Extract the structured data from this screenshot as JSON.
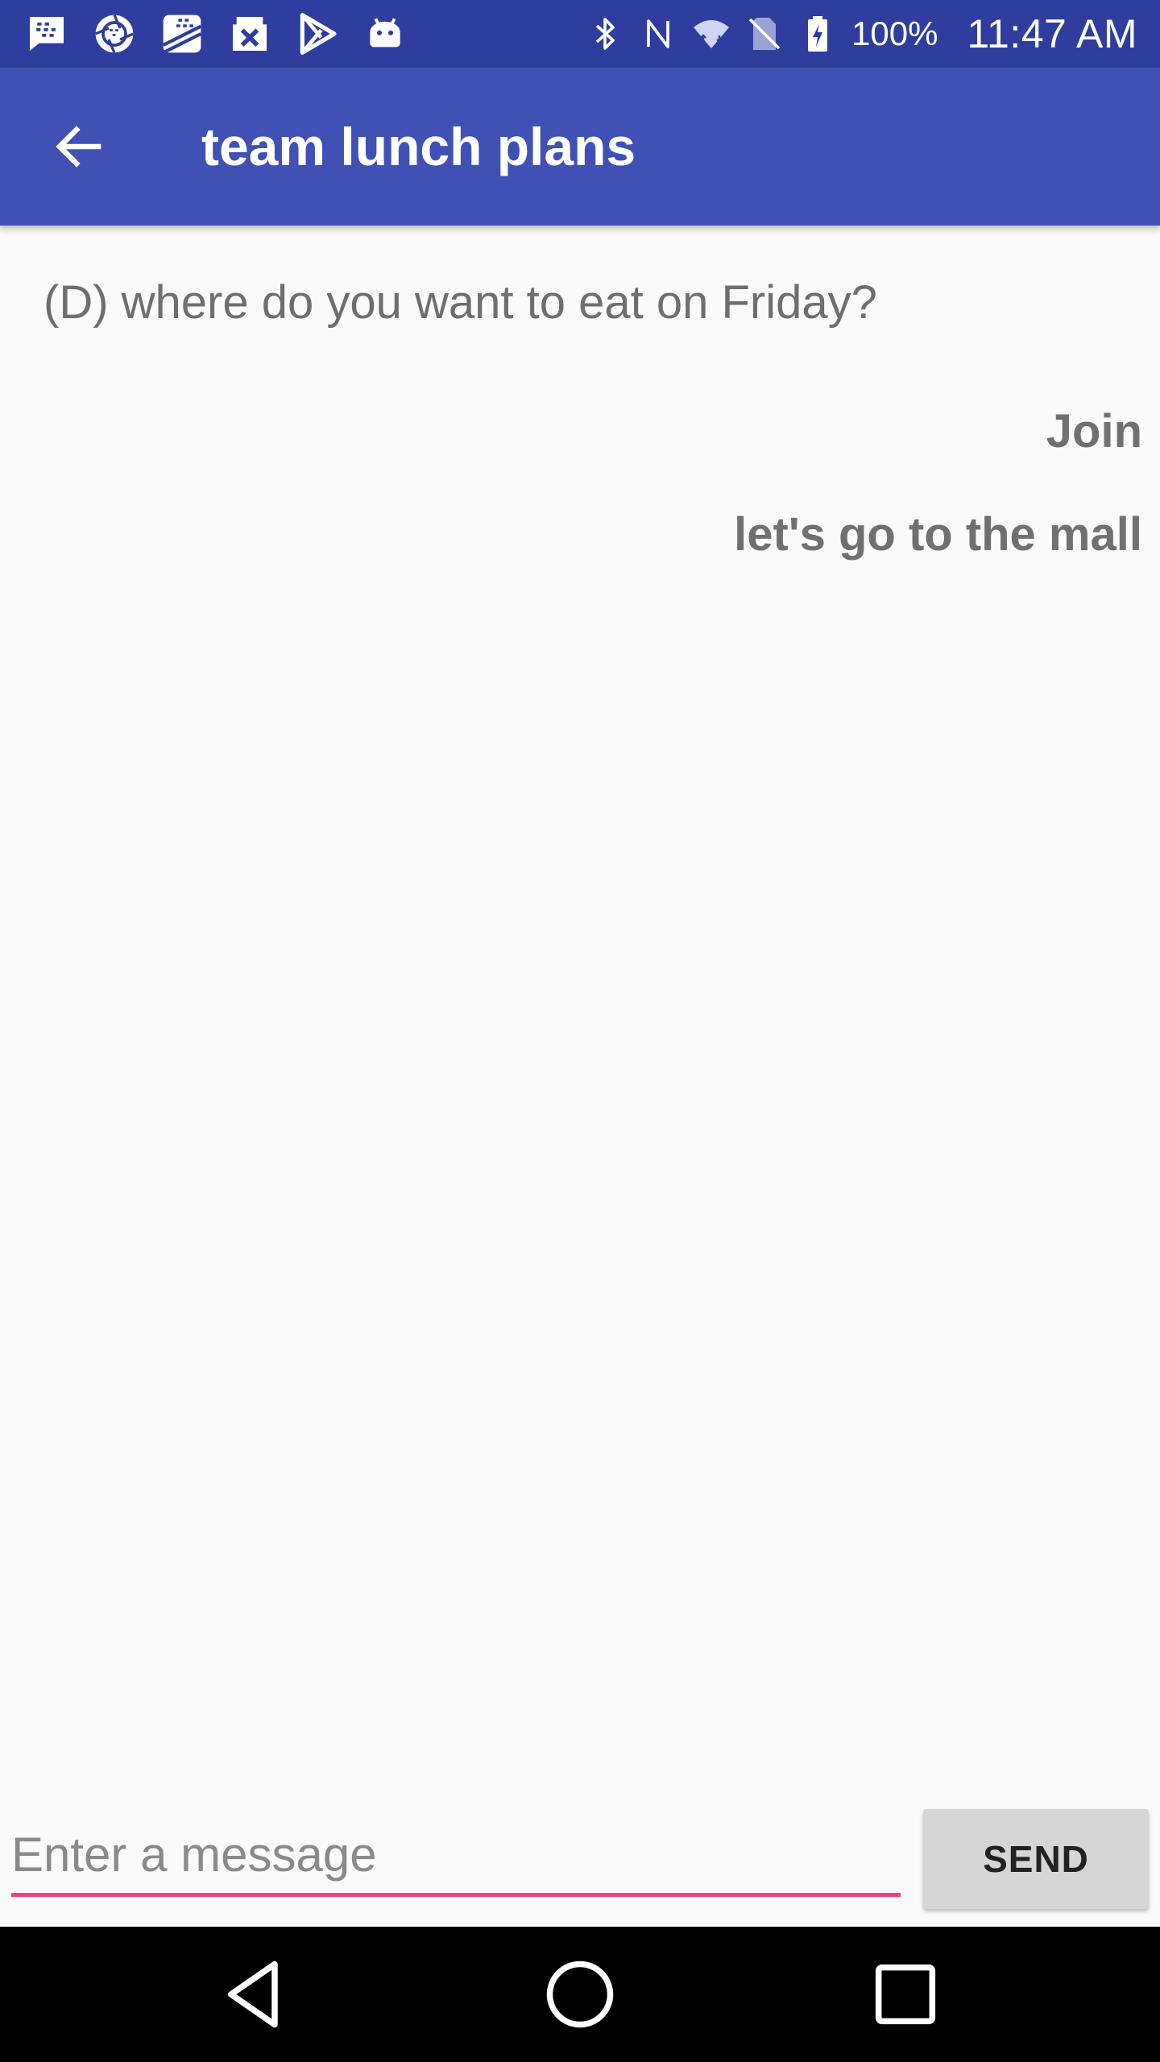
{
  "status_bar": {
    "battery_percent": "100%",
    "time": "11:47 AM",
    "left_icons": [
      "bbm-chat-icon",
      "blackberry-aperture-icon",
      "blackberry-hub-icon",
      "close-box-icon",
      "play-store-icon",
      "android-robot-icon"
    ],
    "right_icons": [
      "bluetooth-icon",
      "nfc-icon",
      "wifi-icon",
      "no-sim-icon",
      "battery-charging-icon"
    ],
    "colors": {
      "background": "#2f3e9e",
      "foreground": "#ffffff"
    }
  },
  "app_bar": {
    "title": "team lunch plans",
    "back_icon": "arrow-back-icon",
    "color": "#3f51b5"
  },
  "conversation": {
    "topic": "(D) where do you want to eat on Friday?",
    "messages": [
      {
        "text": "Join"
      },
      {
        "text": "let's go to the mall"
      }
    ]
  },
  "composer": {
    "placeholder": "Enter a message",
    "value": "",
    "send_label": "SEND",
    "underline_color": "#f0437a"
  },
  "nav_bar": {
    "icons": [
      "nav-back-icon",
      "nav-home-icon",
      "nav-recents-icon"
    ]
  }
}
